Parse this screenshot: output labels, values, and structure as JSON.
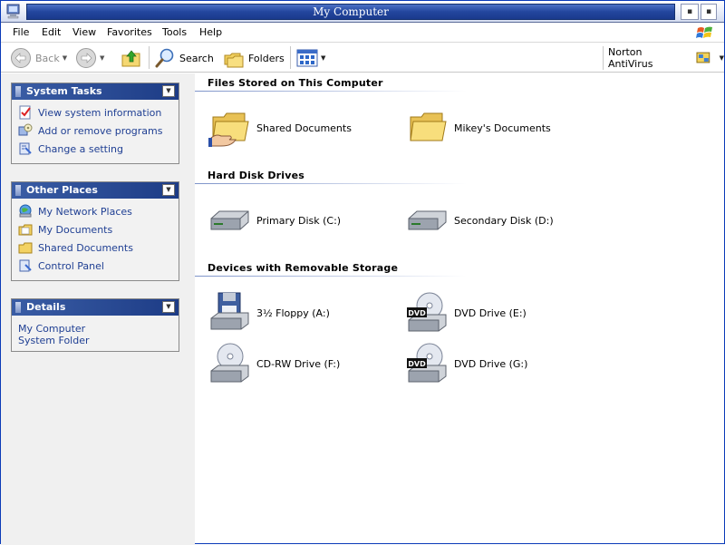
{
  "window": {
    "title": "My Computer",
    "caption_minimize": "▪",
    "caption_maximize": "▪",
    "caption_close": "▪"
  },
  "menu": [
    "File",
    "Edit",
    "View",
    "Favorites",
    "Tools",
    "Help"
  ],
  "toolbar": {
    "back": "Back",
    "search": "Search",
    "folders": "Folders",
    "norton": "Norton AntiVirus"
  },
  "side": {
    "system_tasks": {
      "title": "System Tasks",
      "items": [
        "View system information",
        "Add or remove programs",
        "Change a setting"
      ]
    },
    "other_places": {
      "title": "Other Places",
      "items": [
        "My Network Places",
        "My Documents",
        "Shared Documents",
        "Control Panel"
      ]
    },
    "details": {
      "title": "Details",
      "lines": [
        "My Computer",
        "System Folder"
      ]
    }
  },
  "groups": {
    "files": {
      "title": "Files Stored on This Computer",
      "items": [
        "Shared Documents",
        "Mikey's Documents"
      ]
    },
    "hard_disks": {
      "title": "Hard Disk Drives",
      "items": [
        "Primary Disk (C:)",
        "Secondary Disk (D:)"
      ]
    },
    "removable": {
      "title": "Devices with Removable Storage",
      "items": [
        "3½ Floppy (A:)",
        "DVD Drive (E:)",
        "CD-RW Drive (F:)",
        "DVD Drive (G:)"
      ],
      "dvd_badge": "DVD"
    }
  },
  "colors": {
    "title_band": "#23469e",
    "panel_header": "#2a4b98",
    "link_blue": "#1f3f93"
  }
}
